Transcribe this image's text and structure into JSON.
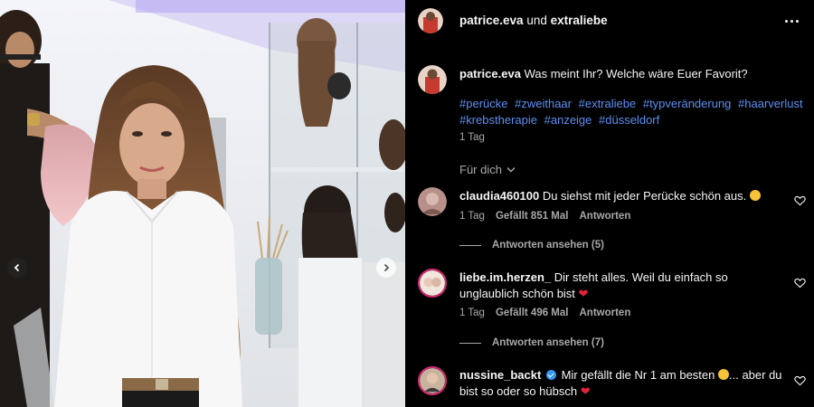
{
  "header": {
    "user1": "patrice.eva",
    "connector": "und",
    "user2": "extraliebe"
  },
  "caption": {
    "username": "patrice.eva",
    "text": "Was meint Ihr? Welche wäre Euer Favorit?",
    "hashtags": [
      "#perücke",
      "#zweithaar",
      "#extraliebe",
      "#typveränderung",
      "#haarverlust",
      "#krebstherapie",
      "#anzeige",
      "#düsseldorf"
    ],
    "time": "1 Tag"
  },
  "filter": {
    "label": "Für dich"
  },
  "comments": [
    {
      "username": "claudia460100",
      "text": "Du siehst mit jeder Perücke schön aus.",
      "emoji": "heart-eyes",
      "time": "1 Tag",
      "likes": "Gefällt 851 Mal",
      "reply": "Antworten",
      "view_replies": "Antworten ansehen (5)"
    },
    {
      "username": "liebe.im.herzen_",
      "text": "Dir steht alles. Weil du einfach so unglaublich schön bist",
      "emoji": "red-heart",
      "time": "1 Tag",
      "likes": "Gefällt 496 Mal",
      "reply": "Antworten",
      "view_replies": "Antworten ansehen (7)"
    },
    {
      "username": "nussine_backt",
      "verified": true,
      "text_before": "Mir gefällt die Nr 1 am besten",
      "text_after": "... aber du bist so oder so hübsch",
      "emoji1": "heart-eyes",
      "emoji2": "red-heart"
    }
  ],
  "icons": {
    "more": "more-horizontal-icon",
    "heart": "heart-outline-icon",
    "chevron": "chevron-down-icon",
    "prev": "chevron-left-icon",
    "next": "chevron-right-icon"
  },
  "colors": {
    "background": "#000000",
    "text": "#f5f5f5",
    "secondary": "#a8a8a8",
    "hashtag": "#5c8ff0",
    "verified": "#3797f0",
    "heart": "#e2233f"
  }
}
